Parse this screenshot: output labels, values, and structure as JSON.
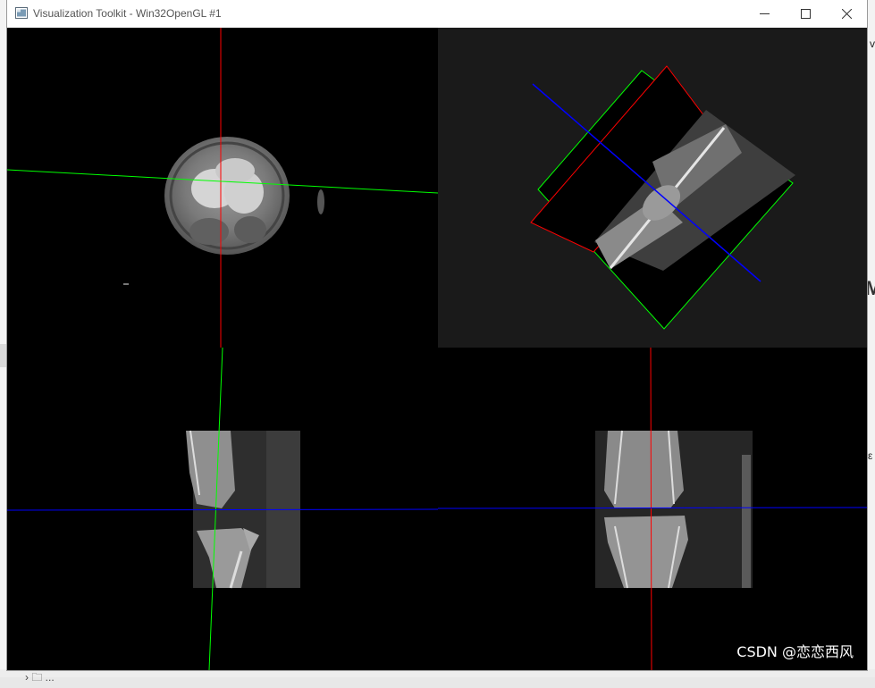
{
  "window": {
    "title": "Visualization Toolkit - Win32OpenGL #1",
    "controls": {
      "minimize": "—",
      "maximize": "☐",
      "close": "✕"
    }
  },
  "background": {
    "right_fragment_1": "v",
    "right_fragment_2": "M",
    "right_fragment_3": "ε",
    "bottom_fragment": "› 🗀 ..."
  },
  "viewports": [
    {
      "name": "axial-view",
      "background": "#000000"
    },
    {
      "name": "3d-view",
      "background": "#1a1a1a"
    },
    {
      "name": "sagittal-view",
      "background": "#000000"
    },
    {
      "name": "coronal-view",
      "background": "#000000"
    }
  ],
  "crosshair_colors": {
    "red": "#ff0000",
    "green": "#00ff00",
    "blue": "#0000ff"
  },
  "watermark": "CSDN @恋恋西风"
}
